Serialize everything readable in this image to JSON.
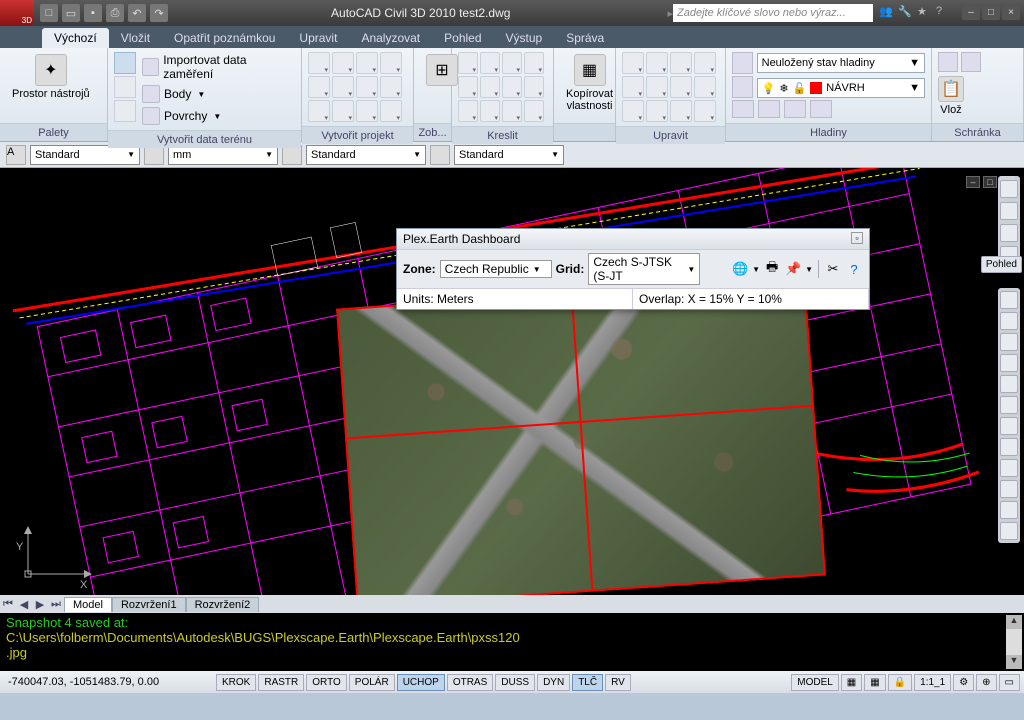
{
  "title": "AutoCAD Civil 3D 2010    test2.dwg",
  "search_placeholder": "Zadejte klíčové slovo nebo výraz...",
  "tabs": [
    "Výchozí",
    "Vložit",
    "Opatřit poznámkou",
    "Upravit",
    "Analyzovat",
    "Pohled",
    "Výstup",
    "Správa"
  ],
  "active_tab": 0,
  "panels": {
    "p1": {
      "label": "Palety",
      "big": "Prostor nástrojů"
    },
    "p2": {
      "label": "Vytvořit data terénu",
      "items": [
        "Importovat data zaměření",
        "Body",
        "Povrchy"
      ]
    },
    "p3": {
      "label": "Vytvořit projekt"
    },
    "p35": {
      "label": "Zob..."
    },
    "p4": {
      "label": "Kreslit"
    },
    "p5": {
      "label": "",
      "big": "Kopírovat\nvlastnosti"
    },
    "p6": {
      "label": "Upravit"
    },
    "p7": {
      "label": "Hladiny",
      "state": "Neuložený stav hladiny",
      "layer": "NÁVRH"
    },
    "p8": {
      "label": "Schránka",
      "big": "Vlož"
    }
  },
  "combos": {
    "c1": "Standard",
    "c2": "mm",
    "c3": "Standard",
    "c4": "Standard"
  },
  "plex": {
    "title": "Plex.Earth Dashboard",
    "zone_lbl": "Zone:",
    "zone": "Czech Republic",
    "grid_lbl": "Grid:",
    "grid": "Czech S-JTSK (S-JT",
    "units": "Units: Meters",
    "overlap": "Overlap:  X = 15%  Y = 10%"
  },
  "nav_label": "Pohled",
  "model_tabs": [
    "Model",
    "Rozvržení1",
    "Rozvržení2"
  ],
  "cmd": {
    "l1": "Snapshot 4 saved at:",
    "l2": "C:\\Users\\folberm\\Documents\\Autodesk\\BUGS\\Plexscape.Earth\\Plexscape.Earth\\pxss120",
    "l3": ".jpg"
  },
  "status": {
    "coords": "-740047.03, -1051483.79, 0.00",
    "btns": [
      "KROK",
      "RASTR",
      "ORTO",
      "POLÁR",
      "UCHOP",
      "OTRAS",
      "DUSS",
      "DYN",
      "TLČ",
      "RV"
    ],
    "on": [
      4,
      8
    ],
    "model": "MODEL",
    "scale": "1:1_1"
  }
}
